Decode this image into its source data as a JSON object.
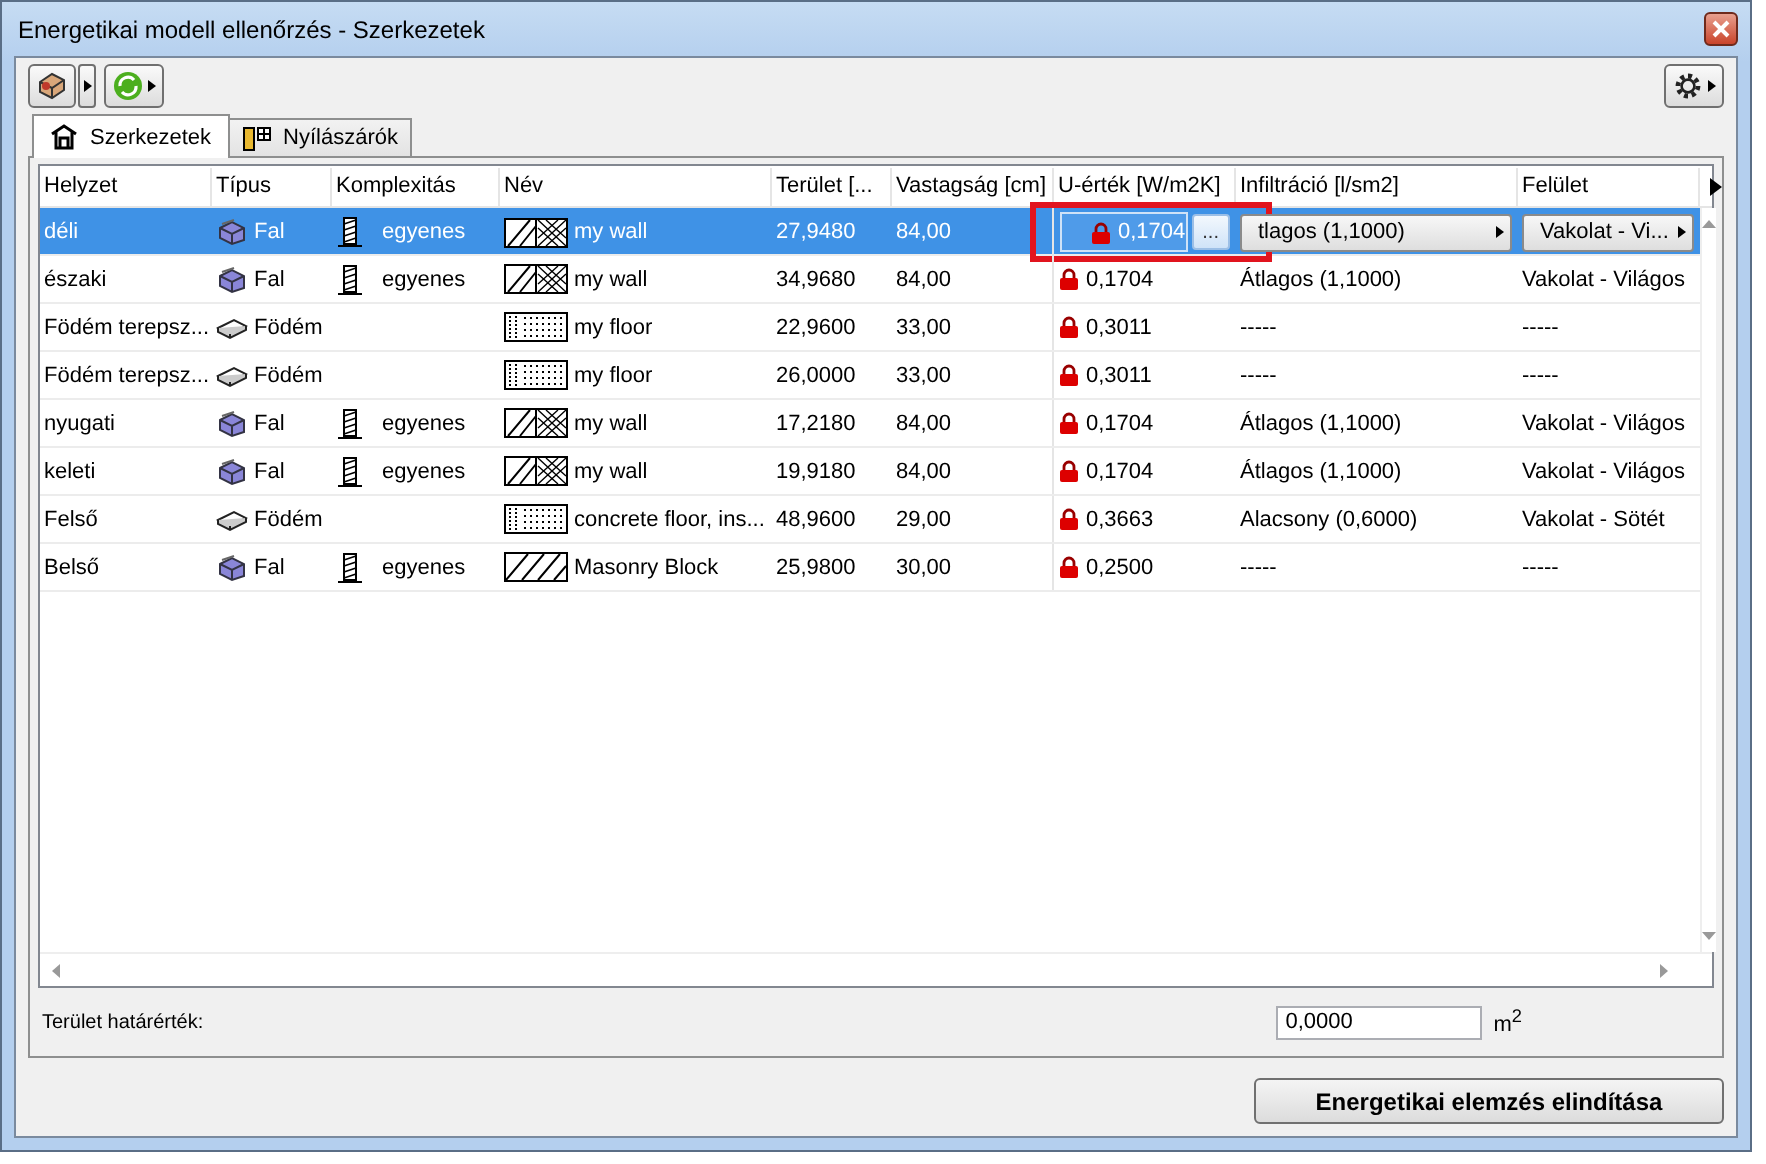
{
  "window": {
    "title": "Energetikai modell ellenőrzés - Szerkezetek"
  },
  "tabs": [
    {
      "label": "Szerkezetek",
      "kind": "house",
      "selected": true
    },
    {
      "label": "Nyílászárók",
      "kind": "window",
      "selected": false
    }
  ],
  "table": {
    "columns": [
      "Helyzet",
      "Típus",
      "Komplexitás",
      "Név",
      "Terület [...",
      "Vastagság [cm]",
      "U-érték [W/m2K]",
      "Infiltráció [l/sm2]",
      "Felület"
    ],
    "rows": [
      {
        "selected": true,
        "highlighted": true,
        "position": "déli",
        "type": {
          "kind": "wall",
          "label": "Fal"
        },
        "complexity": "egyenes",
        "name": {
          "kind": "wall",
          "label": "my wall"
        },
        "area": "27,9480",
        "thickness": "84,00",
        "u_value": "0,1704",
        "infiltration": "tlagos (1,1000)",
        "surface": "Vakolat - Vi..."
      },
      {
        "selected": false,
        "highlighted": false,
        "position": "északi",
        "type": {
          "kind": "wall",
          "label": "Fal"
        },
        "complexity": "egyenes",
        "name": {
          "kind": "wall",
          "label": "my wall"
        },
        "area": "34,9680",
        "thickness": "84,00",
        "u_value": "0,1704",
        "infiltration": "Átlagos (1,1000)",
        "surface": "Vakolat - Világos"
      },
      {
        "selected": false,
        "highlighted": false,
        "position": "Födém terepsz...",
        "type": {
          "kind": "slab",
          "label": "Födém"
        },
        "name": {
          "kind": "floor",
          "label": "my floor"
        },
        "area": "22,9600",
        "thickness": "33,00",
        "u_value": "0,3011",
        "infiltration": "-----",
        "surface": "-----"
      },
      {
        "selected": false,
        "highlighted": false,
        "position": "Födém terepsz...",
        "type": {
          "kind": "slab",
          "label": "Födém"
        },
        "name": {
          "kind": "floor",
          "label": "my floor"
        },
        "area": "26,0000",
        "thickness": "33,00",
        "u_value": "0,3011",
        "infiltration": "-----",
        "surface": "-----"
      },
      {
        "selected": false,
        "highlighted": false,
        "position": "nyugati",
        "type": {
          "kind": "wall",
          "label": "Fal"
        },
        "complexity": "egyenes",
        "name": {
          "kind": "wall",
          "label": "my wall"
        },
        "area": "17,2180",
        "thickness": "84,00",
        "u_value": "0,1704",
        "infiltration": "Átlagos (1,1000)",
        "surface": "Vakolat - Világos"
      },
      {
        "selected": false,
        "highlighted": false,
        "position": "keleti",
        "type": {
          "kind": "wall",
          "label": "Fal"
        },
        "complexity": "egyenes",
        "name": {
          "kind": "wall",
          "label": "my wall"
        },
        "area": "19,9180",
        "thickness": "84,00",
        "u_value": "0,1704",
        "infiltration": "Átlagos (1,1000)",
        "surface": "Vakolat - Világos"
      },
      {
        "selected": false,
        "highlighted": false,
        "position": "Felső",
        "type": {
          "kind": "slab",
          "label": "Födém"
        },
        "name": {
          "kind": "floor",
          "label": "concrete floor, ins..."
        },
        "area": "48,9600",
        "thickness": "29,00",
        "u_value": "0,3663",
        "infiltration": "Alacsony (0,6000)",
        "surface": "Vakolat - Sötét"
      },
      {
        "selected": false,
        "highlighted": false,
        "position": "Belső",
        "type": {
          "kind": "wall",
          "label": "Fal"
        },
        "complexity": "egyenes",
        "name": {
          "kind": "block",
          "label": "Masonry Block"
        },
        "area": "25,9800",
        "thickness": "30,00",
        "u_value": "0,2500",
        "infiltration": "-----",
        "surface": "-----"
      }
    ],
    "more_button": "..."
  },
  "footer": {
    "label": "Terület határérték:",
    "value": "0,0000",
    "unit": "m$^{2}$"
  },
  "buttons": [
    "Energetikai elemzés elindítása"
  ]
}
